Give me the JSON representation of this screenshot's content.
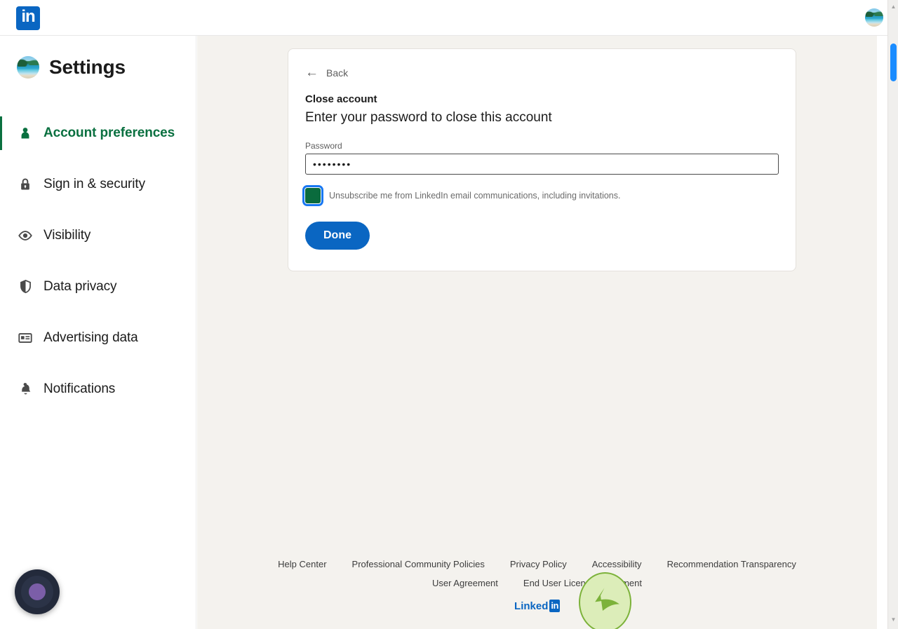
{
  "topbar": {
    "logo_text": "in",
    "logo_icon": "linkedin-logo-icon",
    "avatar_icon": "user-avatar-photo"
  },
  "sidebar": {
    "title": "Settings",
    "avatar_icon": "user-avatar-photo",
    "items": [
      {
        "label": "Account preferences",
        "icon": "person-icon",
        "active": true
      },
      {
        "label": "Sign in & security",
        "icon": "lock-icon",
        "active": false
      },
      {
        "label": "Visibility",
        "icon": "eye-icon",
        "active": false
      },
      {
        "label": "Data privacy",
        "icon": "shield-icon",
        "active": false
      },
      {
        "label": "Advertising data",
        "icon": "ad-card-icon",
        "active": false
      },
      {
        "label": "Notifications",
        "icon": "bell-icon",
        "active": false
      }
    ]
  },
  "card": {
    "back_label": "Back",
    "back_icon": "arrow-left-icon",
    "eyebrow": "Close account",
    "heading": "Enter your password to close this account",
    "password_label": "Password",
    "password_value": "••••••••",
    "password_placeholder": "",
    "checkbox_label": "Unsubscribe me from LinkedIn email communications, including invitations.",
    "checkbox_checked": "true",
    "done_label": "Done"
  },
  "footer": {
    "row1": [
      "Help Center",
      "Professional Community Policies",
      "Privacy Policy",
      "Accessibility",
      "Recommendation Transparency"
    ],
    "row2": [
      "User Agreement",
      "End User License Agreement"
    ],
    "brand_word": "Linked",
    "brand_mark": "in"
  },
  "overlays": {
    "cursor_icon": "cursor-arrow-highlight",
    "fab_icon": "record-button-icon"
  },
  "scrollbar": {
    "up_arrow": "▲",
    "down_arrow": "▼"
  },
  "colors": {
    "linkedin_blue": "#0a66c2",
    "active_green": "#0a7040",
    "checkbox_green": "#0a6b3d",
    "page_bg": "#f4f2ee",
    "focus_blue": "#1877f2",
    "scroll_thumb": "#1a8cff"
  }
}
